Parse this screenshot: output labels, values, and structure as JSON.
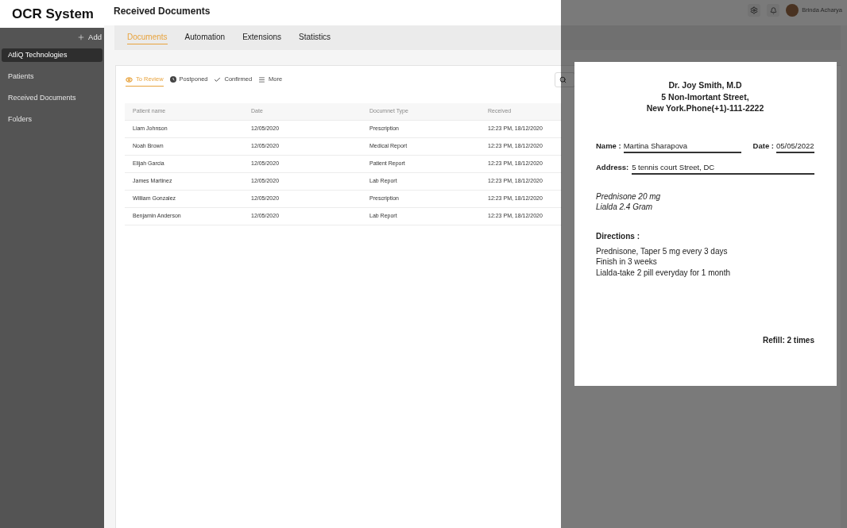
{
  "sidebar": {
    "title": "OCR System",
    "add_label": "Add",
    "items": [
      {
        "label": "AtliQ Technologies",
        "selected": true
      },
      {
        "label": "Patients",
        "selected": false
      },
      {
        "label": "Received Documents",
        "selected": false
      },
      {
        "label": "Folders",
        "selected": false
      }
    ]
  },
  "header": {
    "title": "Received Documents",
    "user_name": "Brinda Acharya"
  },
  "tabs": [
    {
      "label": "Documents",
      "selected": true
    },
    {
      "label": "Automation",
      "selected": false
    },
    {
      "label": "Extensions",
      "selected": false
    },
    {
      "label": "Statistics",
      "selected": false
    }
  ],
  "filters": [
    {
      "kind": "review",
      "label": "To Review",
      "selected": true
    },
    {
      "kind": "postponed",
      "label": "Postponed",
      "selected": false
    },
    {
      "kind": "confirmed",
      "label": "Confirmed",
      "selected": false
    },
    {
      "kind": "more",
      "label": "More",
      "selected": false
    }
  ],
  "table": {
    "columns": [
      "Patient name",
      "Date",
      "Documnet Type",
      "Received"
    ],
    "rows": [
      [
        "Liam Johnson",
        "12/05/2020",
        "Prescription",
        "12:23 PM, 18/12/2020"
      ],
      [
        "Noah Brown",
        "12/05/2020",
        "Medical Report",
        "12:23 PM, 18/12/2020"
      ],
      [
        "Elijah Garcia",
        "12/05/2020",
        "Patient Report",
        "12:23 PM, 18/12/2020"
      ],
      [
        "James Martinez",
        "12/05/2020",
        "Lab Report",
        "12:23 PM, 18/12/2020"
      ],
      [
        "William Gonzalez",
        "12/05/2020",
        "Prescription",
        "12:23 PM, 18/12/2020"
      ],
      [
        "Benjamin Anderson",
        "12/05/2020",
        "Lab Report",
        "12:23 PM, 18/12/2020"
      ]
    ]
  },
  "document": {
    "letterhead": [
      "Dr. Joy Smith, M.D",
      "5 Non-Imortant Street,",
      "New York.Phone(+1)-111-2222"
    ],
    "name": {
      "label": "Name :",
      "value": "Martina Sharapova"
    },
    "date": {
      "label": "Date :",
      "value": "05/05/2022"
    },
    "address": {
      "label": "Address:",
      "value": "5 tennis court Street, DC"
    },
    "medications": [
      "Prednisone 20 mg",
      "Lialda 2.4 Gram"
    ],
    "directions_title": "Directions :",
    "directions": [
      "Prednisone, Taper 5 mg every 3 days",
      "Finish in 3 weeks",
      "Lialda-take 2 pill everyday for 1 month"
    ],
    "refill": "Refill: 2 times"
  }
}
